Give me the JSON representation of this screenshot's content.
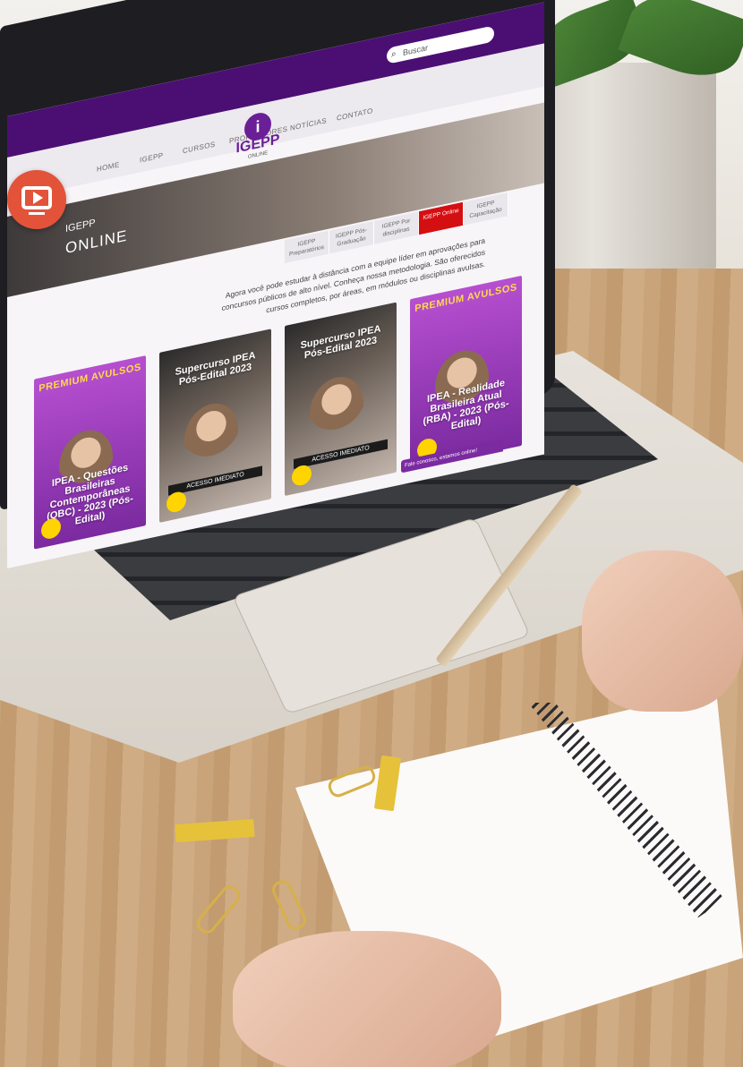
{
  "site": {
    "search_placeholder": "Buscar",
    "nav": [
      "HOME",
      "IGEPP",
      "CURSOS",
      "PROFESSORES",
      "NOTÍCIAS",
      "CONTATO"
    ],
    "logo": {
      "mark": "i",
      "word": "IGEPP",
      "sub": "ONLINE"
    },
    "hero": {
      "line1": "IGEPP",
      "line2": "ONLINE"
    },
    "tabs": [
      {
        "label": "IGEPP Preparatórios",
        "active": false
      },
      {
        "label": "IGEPP Pós-Graduação",
        "active": false
      },
      {
        "label": "IGEPP Por disciplinas",
        "active": false
      },
      {
        "label": "IGEPP Online",
        "active": true
      },
      {
        "label": "IGEPP Capacitação",
        "active": false
      }
    ],
    "intro": "Agora você pode estudar à distância com a equipe líder em aprovações para concursos públicos de alto nível. Conheça nossa metodologia. São oferecidos cursos completos, por áreas, em módulos ou disciplinas avulsas.",
    "cards": [
      {
        "badge": "PREMIUM AVULSOS",
        "title": "IPEA - Questões Brasileiras Contemporâneas (QBC) - 2023 (Pós-Edital)",
        "cta": "",
        "style": "purple"
      },
      {
        "badge": "",
        "title": "Supercurso IPEA Pós-Edital 2023",
        "cta": "ACESSO IMEDIATO",
        "style": "photo"
      },
      {
        "badge": "",
        "title": "Supercurso IPEA Pós-Edital 2023",
        "cta": "ACESSO IMEDIATO",
        "style": "photo"
      },
      {
        "badge": "PREMIUM AVULSOS",
        "title": "IPEA - Realidade Brasileira Atual (RBA) - 2023 (Pós-Edital)",
        "cta": "",
        "style": "purple"
      }
    ],
    "chat": "Fale conosco, estamos online!"
  },
  "colors": {
    "brand_purple": "#4b0f73",
    "accent_red": "#d40f12",
    "icon_orange": "#e2533a"
  }
}
